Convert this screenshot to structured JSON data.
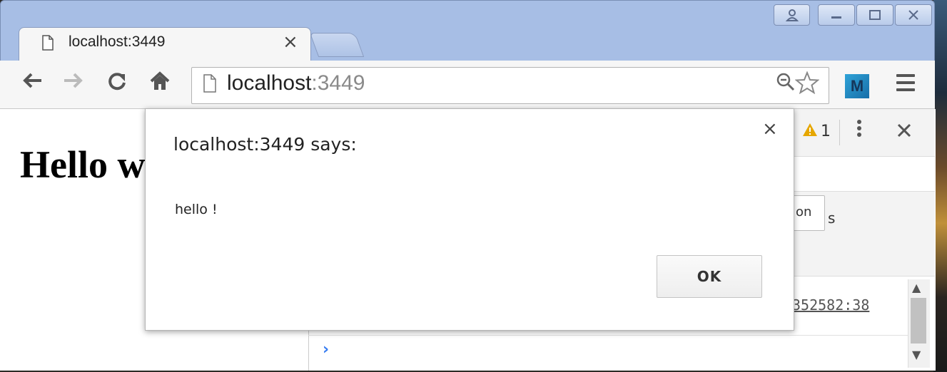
{
  "browser": {
    "tab": {
      "title": "localhost:3449",
      "close_glyph": "×"
    },
    "omnibox": {
      "host": "localhost",
      "port": ":3449"
    },
    "extension_label": "M"
  },
  "page": {
    "heading": "Hello w"
  },
  "devtools": {
    "warning_count": "1",
    "chip_text": "on",
    "chip_suffix": "s",
    "source_link": "352582:38",
    "prompt_glyph": "›"
  },
  "dialog": {
    "title": "localhost:3449 says:",
    "message": "hello !",
    "ok_label": "OK",
    "close_glyph": "×"
  },
  "colors": {
    "frame": "#a7bee5",
    "toolbar": "#f6f6f6",
    "extension": "#2fa3d8",
    "warning": "#e6a700",
    "console_prompt": "#367cf1"
  },
  "icons": [
    "page-icon",
    "back-arrow-icon",
    "forward-arrow-icon",
    "reload-icon",
    "home-icon",
    "zoom-icon",
    "star-icon",
    "menu-icon",
    "warning-icon",
    "more-icon",
    "close-icon",
    "profile-icon",
    "minimize-icon",
    "maximize-icon"
  ]
}
